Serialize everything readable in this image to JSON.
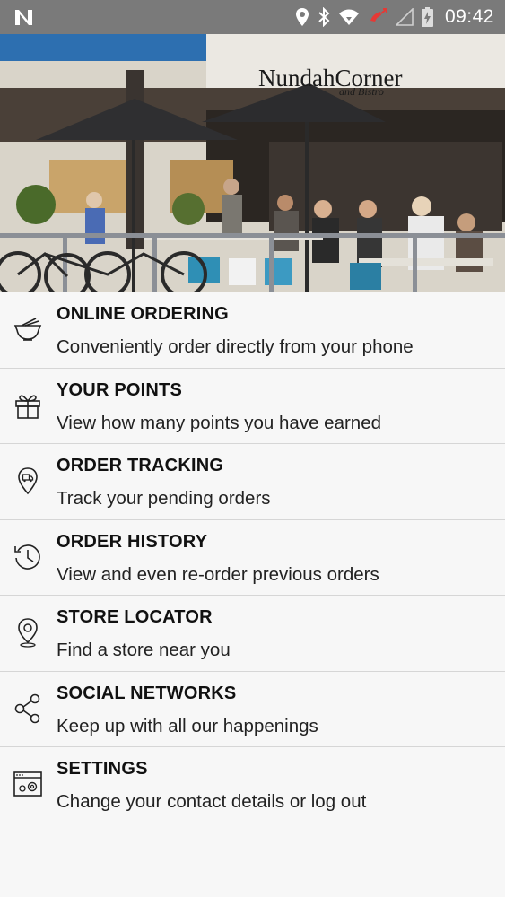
{
  "status_bar": {
    "time": "09:42",
    "icons": [
      "notification-n-icon",
      "location-icon",
      "bluetooth-icon",
      "wifi-icon",
      "missed-call-icon",
      "signal-icon",
      "battery-charging-icon"
    ],
    "background": "#7a7a7a"
  },
  "hero": {
    "sign_text": "NundahCorner",
    "sign_subtext": "and Bistro"
  },
  "menu": [
    {
      "title": "ONLINE ORDERING",
      "subtitle": "Conveniently order directly from your phone",
      "icon": "bowl-icon"
    },
    {
      "title": "YOUR POINTS",
      "subtitle": "View how many points you have earned",
      "icon": "gift-icon"
    },
    {
      "title": "ORDER TRACKING",
      "subtitle": "Track your pending orders",
      "icon": "delivery-pin-icon"
    },
    {
      "title": "ORDER HISTORY",
      "subtitle": "View and even re-order previous orders",
      "icon": "history-icon"
    },
    {
      "title": "STORE LOCATOR",
      "subtitle": "Find a store near you",
      "icon": "location-pin-icon"
    },
    {
      "title": "SOCIAL NETWORKS",
      "subtitle": "Keep up with all our happenings",
      "icon": "share-icon"
    },
    {
      "title": "SETTINGS",
      "subtitle": "Change your contact details or log out",
      "icon": "settings-window-icon"
    }
  ]
}
